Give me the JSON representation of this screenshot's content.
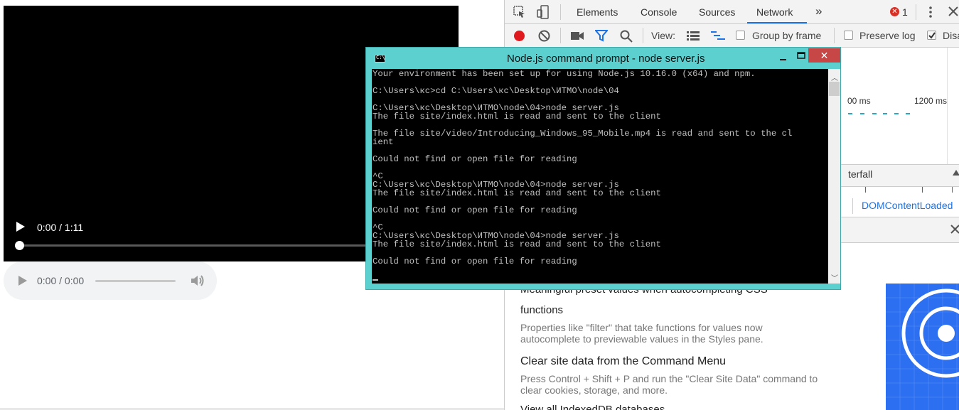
{
  "video": {
    "time": "0:00 / 1:11",
    "progress": 0
  },
  "audio": {
    "time": "0:00 / 0:00"
  },
  "devtools": {
    "tabs": [
      "Elements",
      "Console",
      "Sources",
      "Network"
    ],
    "active_tab": "Network",
    "more_tabs": "»",
    "error_count": "1",
    "toolbar": {
      "view_label": "View:",
      "group_by_frame": "Group by frame",
      "preserve_log": "Preserve log",
      "disable_cache": "Disa"
    },
    "timeline_labels": [
      "00 ms",
      "1200 ms"
    ],
    "waterfall_label": "terfall",
    "dom_content_loaded": "DOMContentLoaded",
    "whats_new": {
      "partial_heading": "Meaningful preset values when autocompleting CSS",
      "partial_heading_2": "functions",
      "item1_desc": "Properties like \"filter\" that take functions for values now autocomplete to previewable values in the Styles pane.",
      "item2_title": "Clear site data from the Command Menu",
      "item2_desc": "Press Control + Shift + P and run the \"Clear Site Data\" command to clear cookies, storage, and more.",
      "item3_partial": "View all IndexedDB databases"
    }
  },
  "console": {
    "title": "Node.js command prompt - node  server.js",
    "close_glyph": "✕",
    "output": "Your environment has been set up for using Node.js 10.16.0 (x64) and npm.\n\nC:\\Users\\кс>cd C:\\Users\\кс\\Desktop\\ИТМО\\node\\04\n\nC:\\Users\\кс\\Desktop\\ИТМО\\node\\04>node server.js\nThe file site/index.html is read and sent to the client\n\nThe file site/video/Introducing_Windows_95_Mobile.mp4 is read and sent to the cl\nient\n\nCould not find or open file for reading\n\n^C\nC:\\Users\\кс\\Desktop\\ИТМО\\node\\04>node server.js\nThe file site/index.html is read and sent to the client\n\nCould not find or open file for reading\n\n^C\nC:\\Users\\кс\\Desktop\\ИТМО\\node\\04>node server.js\nThe file site/index.html is read and sent to the client\n\nCould not find or open file for reading"
  },
  "colors": {
    "accent": "#1a73e8",
    "record": "#e0191f",
    "console_frame": "#5cd0cf",
    "close": "#c74646"
  }
}
